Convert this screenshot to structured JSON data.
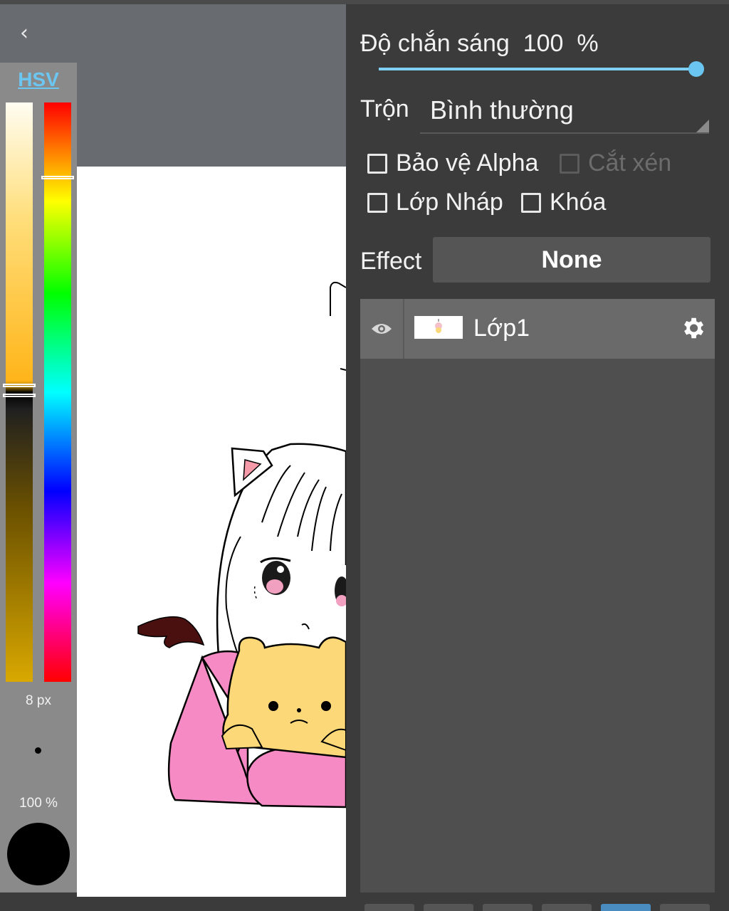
{
  "left_panel": {
    "mode_label": "HSV",
    "brush_size": "8 px",
    "brush_opacity": "100 %",
    "selected_color": "#000000"
  },
  "layer_props": {
    "opacity_label": "Độ chắn sáng",
    "opacity_value": "100",
    "opacity_unit": "%",
    "opacity_fraction": 1.0,
    "blend_label": "Trộn",
    "blend_value": "Bình thường",
    "protect_alpha": "Bảo vệ Alpha",
    "clipping": "Cắt xén",
    "draft_layer": "Lớp Nháp",
    "lock": "Khóa",
    "effect_label": "Effect",
    "effect_value": "None"
  },
  "layers": [
    {
      "name": "Lớp1",
      "visible": true
    }
  ],
  "icons": {
    "back": "chevron-left-icon",
    "visibility": "eye-icon",
    "settings": "gear-icon"
  },
  "colors": {
    "accent": "#6cc6f2",
    "panel_bg": "#3b3b3b",
    "layer_list_bg": "#4f4f4f",
    "layer_row_bg": "#6a6a6a"
  }
}
